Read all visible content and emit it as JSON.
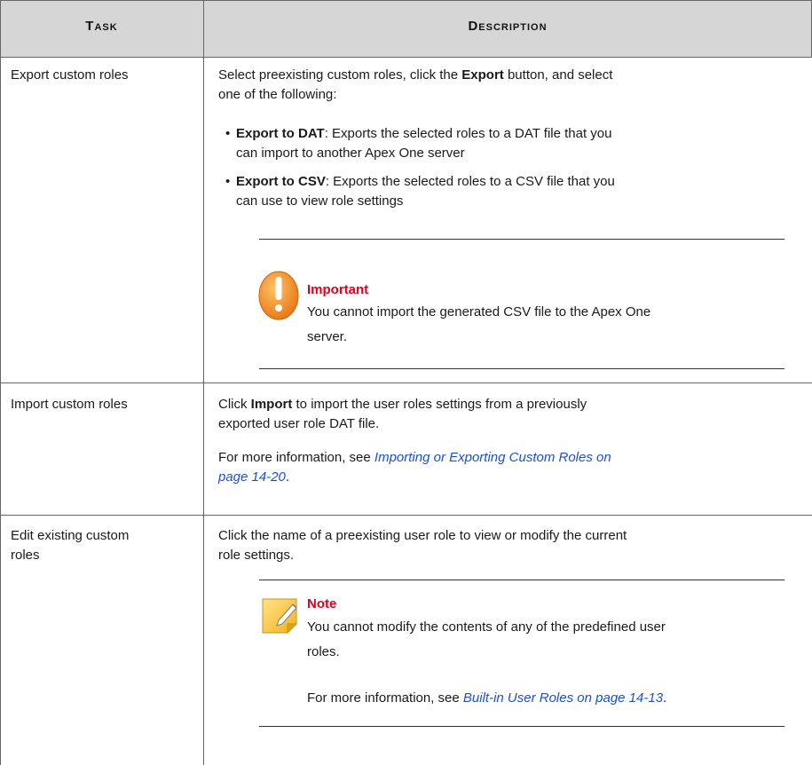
{
  "table": {
    "header": {
      "task": "Task",
      "description": "Description"
    },
    "rows": [
      {
        "task": "Export custom roles",
        "intro_pre": "Select preexisting custom roles, click the ",
        "intro_bold": "Export",
        "intro_post": " button, and select",
        "intro_line2": "one of the following:",
        "bullets": [
          {
            "bold": "Export to DAT",
            "line1": ": Exports the selected roles to a DAT file that you",
            "line2": "can import to another Apex One server"
          },
          {
            "bold": "Export to CSV",
            "line1": ": Exports the selected roles to a CSV file that you",
            "line2": "can use to view role settings"
          }
        ],
        "callout": {
          "icon": "warning-icon",
          "title": "Important",
          "line1": "You cannot import the generated CSV file to the Apex One",
          "line2": "server."
        }
      },
      {
        "task": "Import custom roles",
        "p1_pre": "Click ",
        "p1_bold": "Import",
        "p1_post": " to import the user roles settings from a previously",
        "p1_line2": "exported user role DAT file.",
        "p2_pre": "For more information, see ",
        "p2_link_line1": "Importing or Exporting Custom Roles on",
        "p2_link_line2": "page 14-20",
        "p2_post": "."
      },
      {
        "task_line1": "Edit existing custom",
        "task_line2": "roles",
        "p1_line1": "Click the name of a preexisting user role to view or modify the current",
        "p1_line2": "role settings.",
        "callout": {
          "icon": "note-icon",
          "title": "Note",
          "line1": "You cannot modify the contents of any of the predefined user",
          "line2": "roles.",
          "more_pre": "For more information, see ",
          "more_link": "Built-in User Roles on page 14-13",
          "more_post": "."
        }
      }
    ]
  },
  "colors": {
    "header_bg": "#d6d6d6",
    "rule": "#666666",
    "link": "#1a4fd6",
    "callout_title": "#e2001a",
    "warning_icon": "#f29a1f",
    "note_icon": "#f5c542"
  }
}
